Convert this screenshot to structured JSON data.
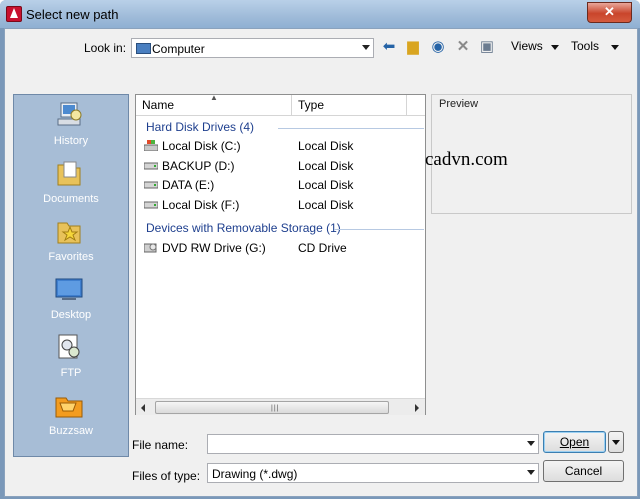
{
  "window": {
    "title": "Select new path",
    "close_label": "✕"
  },
  "toolbar": {
    "look_in_label": "Look in:",
    "look_in_value": "Computer",
    "views_label": "Views",
    "tools_label": "Tools"
  },
  "places": [
    {
      "label": "History",
      "icon": "history-icon"
    },
    {
      "label": "Documents",
      "icon": "documents-icon"
    },
    {
      "label": "Favorites",
      "icon": "favorites-icon"
    },
    {
      "label": "Desktop",
      "icon": "desktop-icon"
    },
    {
      "label": "FTP",
      "icon": "ftp-icon"
    },
    {
      "label": "Buzzsaw",
      "icon": "buzzsaw-icon"
    }
  ],
  "file_list": {
    "columns": {
      "name": "Name",
      "type": "Type"
    },
    "groups": [
      {
        "label": "Hard Disk Drives (4)",
        "items": [
          {
            "name": "Local Disk (C:)",
            "type": "Local Disk"
          },
          {
            "name": "BACKUP (D:)",
            "type": "Local Disk"
          },
          {
            "name": "DATA (E:)",
            "type": "Local Disk"
          },
          {
            "name": "Local Disk (F:)",
            "type": "Local Disk"
          }
        ]
      },
      {
        "label": "Devices with Removable Storage (1)",
        "items": [
          {
            "name": "DVD RW Drive (G:)",
            "type": "CD Drive"
          }
        ]
      }
    ]
  },
  "preview": {
    "label": "Preview",
    "watermark": "cadvn.com"
  },
  "footer": {
    "file_name_label": "File name:",
    "file_name_value": "",
    "files_of_type_label": "Files of type:",
    "files_of_type_value": "Drawing (*.dwg)",
    "open_label": "Open",
    "cancel_label": "Cancel"
  },
  "colors": {
    "places_bg": "#a7bdd6",
    "group_text": "#1e3f8e",
    "close_button": "#c9452b"
  }
}
